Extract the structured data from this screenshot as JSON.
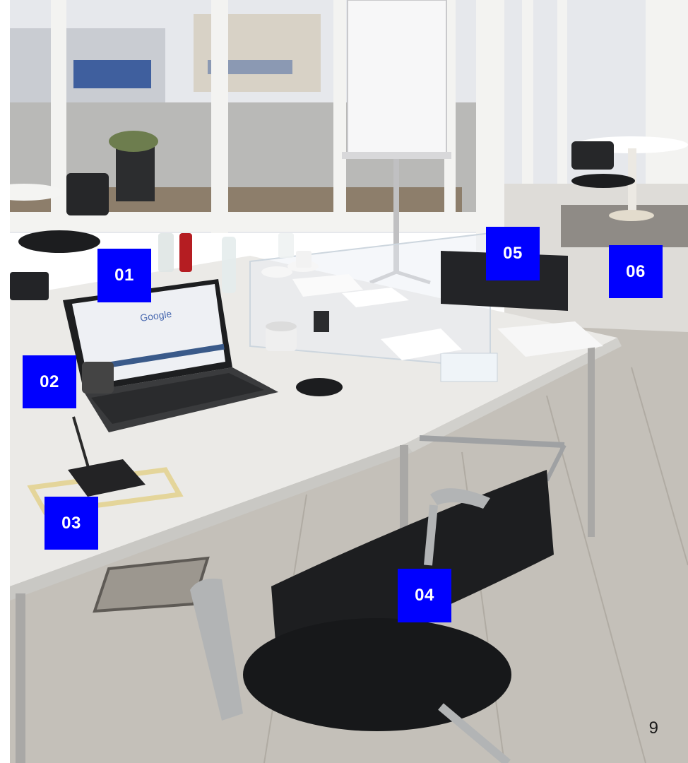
{
  "markers": {
    "m01": "01",
    "m02": "02",
    "m03": "03",
    "m04": "04",
    "m05": "05",
    "m06": "06"
  },
  "laptop_screen": {
    "search_logo": "Google"
  },
  "page_number": "9",
  "colors": {
    "marker_bg": "#0000ff",
    "marker_text": "#ffffff",
    "floor": "#c7c3bd",
    "table_top": "#ecebe8",
    "chair": "#1f2022"
  }
}
